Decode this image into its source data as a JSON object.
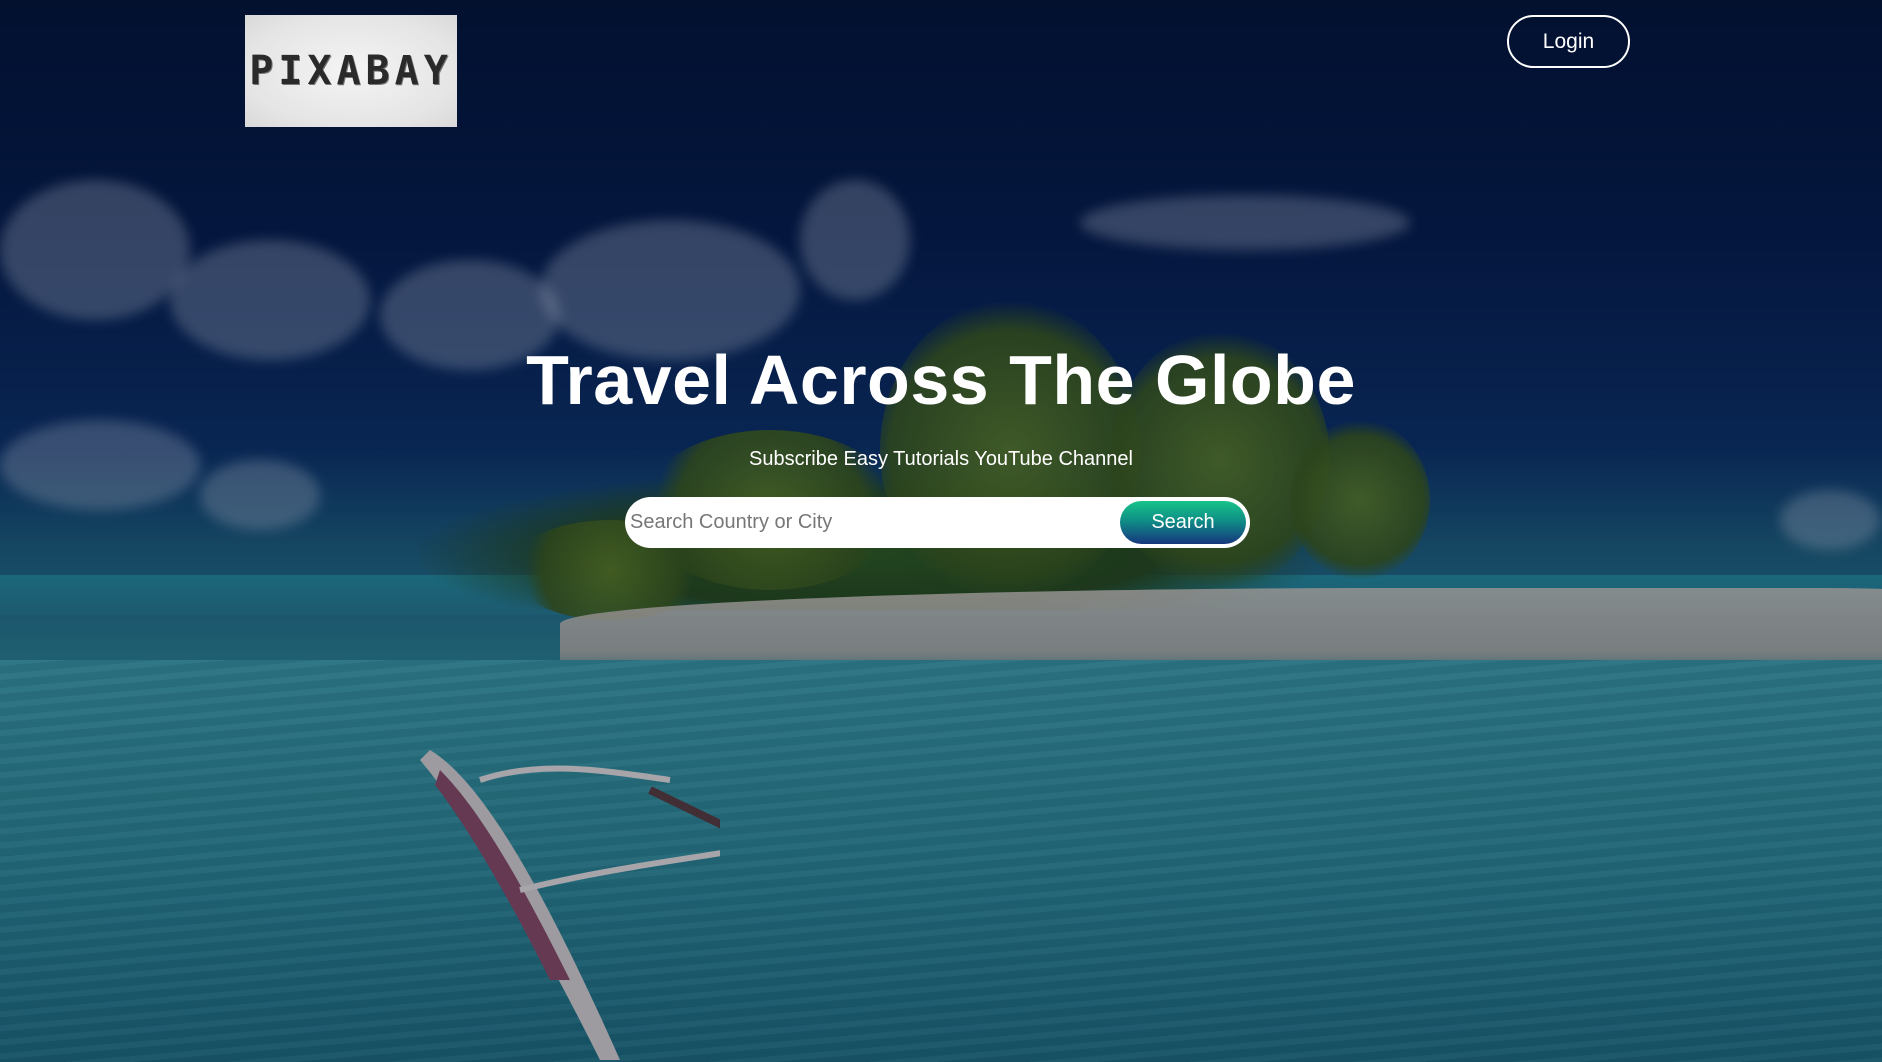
{
  "header": {
    "logo_text": "PIXABAY",
    "login_label": "Login"
  },
  "hero": {
    "title": "Travel Across The Globe",
    "subtitle": "Subscribe Easy Tutorials YouTube Channel"
  },
  "search": {
    "placeholder": "Search Country or City",
    "value": "",
    "button_label": "Search"
  },
  "colors": {
    "search_button_gradient": [
      "#17c38a",
      "#0f8f86",
      "#16377e"
    ],
    "text": "#ffffff"
  }
}
